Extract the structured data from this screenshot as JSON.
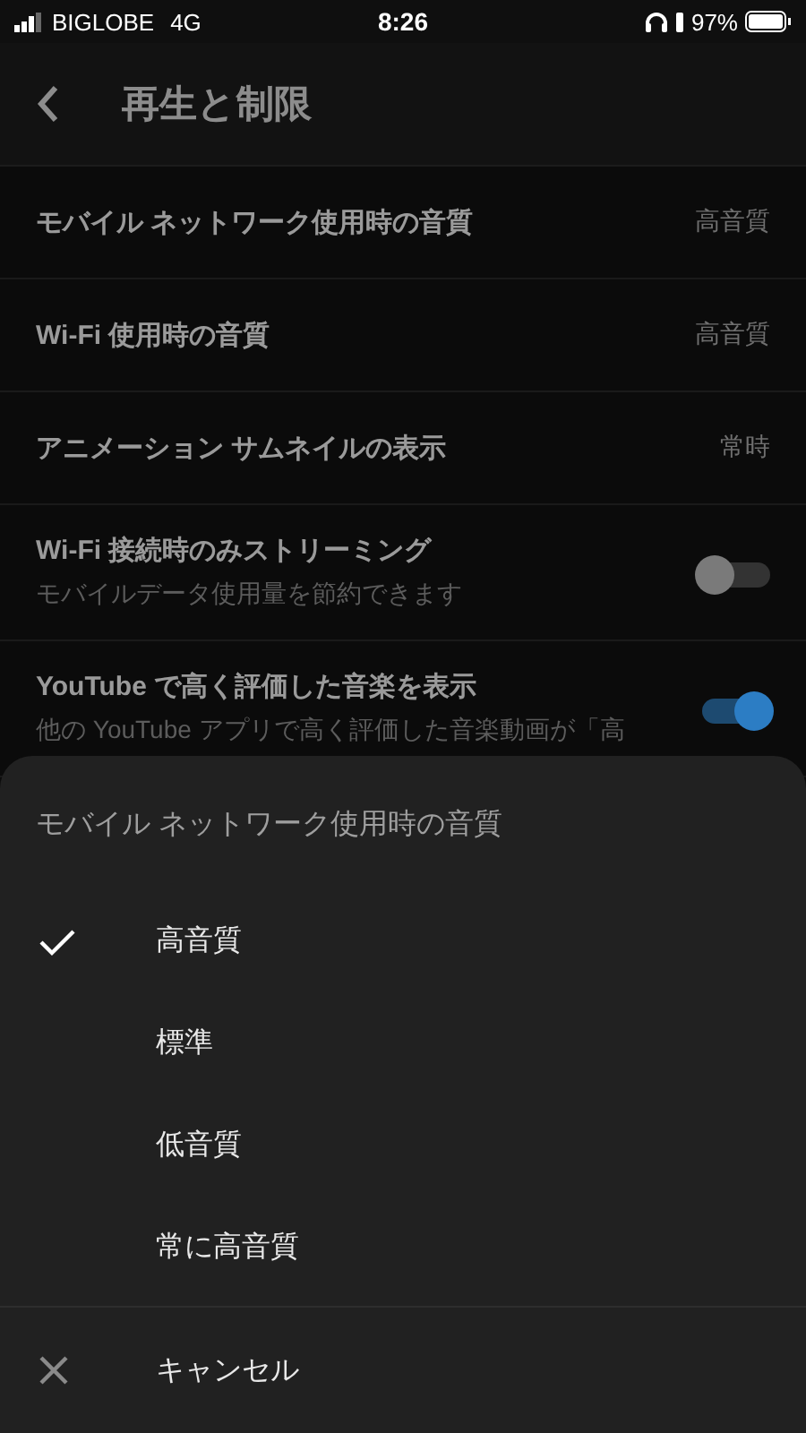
{
  "status_bar": {
    "carrier": "BIGLOBE",
    "network": "4G",
    "time": "8:26",
    "battery": "97%"
  },
  "header": {
    "title": "再生と制限"
  },
  "settings": [
    {
      "kind": "value",
      "label": "モバイル ネットワーク使用時の音質",
      "value": "高音質"
    },
    {
      "kind": "value",
      "label": "Wi-Fi 使用時の音質",
      "value": "高音質"
    },
    {
      "kind": "value",
      "label": "アニメーション サムネイルの表示",
      "value": "常時"
    },
    {
      "kind": "toggle",
      "label": "Wi-Fi 接続時のみストリーミング",
      "description": "モバイルデータ使用量を節約できます",
      "on": false
    },
    {
      "kind": "toggle",
      "label": "YouTube で高く評価した音楽を表示",
      "description": "他の YouTube アプリで高く評価した音楽動画が「高",
      "on": true
    }
  ],
  "sheet": {
    "title": "モバイル ネットワーク使用時の音質",
    "options": [
      {
        "label": "高音質",
        "selected": true
      },
      {
        "label": "標準",
        "selected": false
      },
      {
        "label": "低音質",
        "selected": false
      },
      {
        "label": "常に高音質",
        "selected": false
      }
    ],
    "cancel": "キャンセル"
  }
}
